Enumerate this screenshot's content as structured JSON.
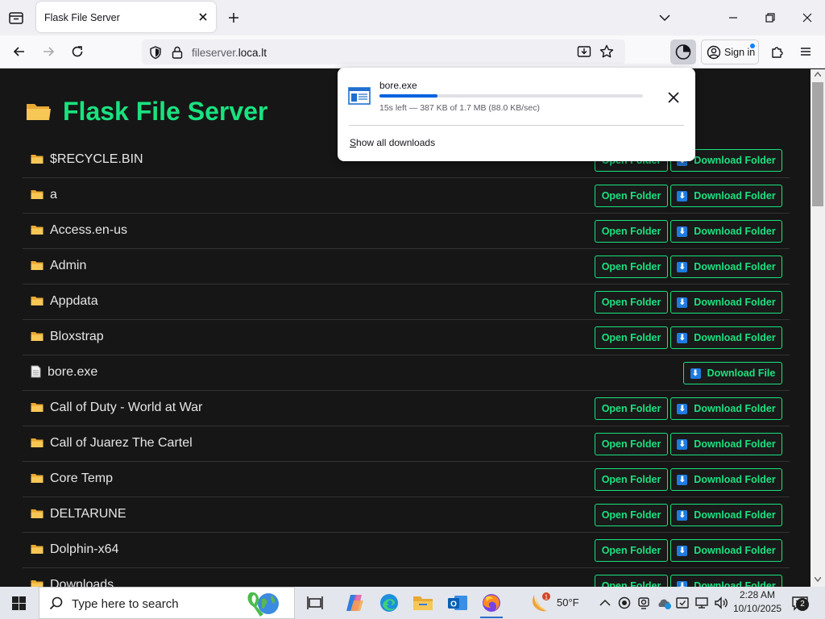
{
  "browser": {
    "tab_title": "Flask File Server",
    "url_prefix": "fileserver.",
    "url_domain": "loca.lt",
    "signin_label": "Sign in"
  },
  "page": {
    "title": "Flask File Server",
    "folder_emoji": "📁",
    "file_emoji": "📄",
    "buttons": {
      "open_folder": "Open Folder",
      "download_folder": "Download Folder",
      "download_file": "Download File",
      "download_glyph": "⬇"
    },
    "items": [
      {
        "name": "$RECYCLE.BIN",
        "type": "folder"
      },
      {
        "name": "a",
        "type": "folder"
      },
      {
        "name": "Access.en-us",
        "type": "folder"
      },
      {
        "name": "Admin",
        "type": "folder"
      },
      {
        "name": "Appdata",
        "type": "folder"
      },
      {
        "name": "Bloxstrap",
        "type": "folder"
      },
      {
        "name": "bore.exe",
        "type": "file"
      },
      {
        "name": "Call of Duty - World at War",
        "type": "folder"
      },
      {
        "name": "Call of Juarez The Cartel",
        "type": "folder"
      },
      {
        "name": "Core Temp",
        "type": "folder"
      },
      {
        "name": "DELTARUNE",
        "type": "folder"
      },
      {
        "name": "Dolphin-x64",
        "type": "folder"
      },
      {
        "name": "Downloads",
        "type": "folder"
      }
    ]
  },
  "downloads_panel": {
    "file_name": "bore.exe",
    "status": "15s left — 387 KB of 1.7 MB (88.0 KB/sec)",
    "progress_fraction": 0.22,
    "show_all_label": "Show all downloads"
  },
  "taskbar": {
    "search_placeholder": "Type here to search",
    "weather_temp": "50°F",
    "weather_badge": "1",
    "time": "2:28 AM",
    "date": "10/10/2025",
    "notification_count": "2",
    "apps": [
      "task-view",
      "copilot",
      "edge",
      "file-explorer",
      "outlook",
      "firefox"
    ]
  },
  "colors": {
    "accent_green": "#19e27f",
    "page_bg": "#161616",
    "download_blue": "#1e7be0",
    "progress_blue": "#0061e0"
  }
}
